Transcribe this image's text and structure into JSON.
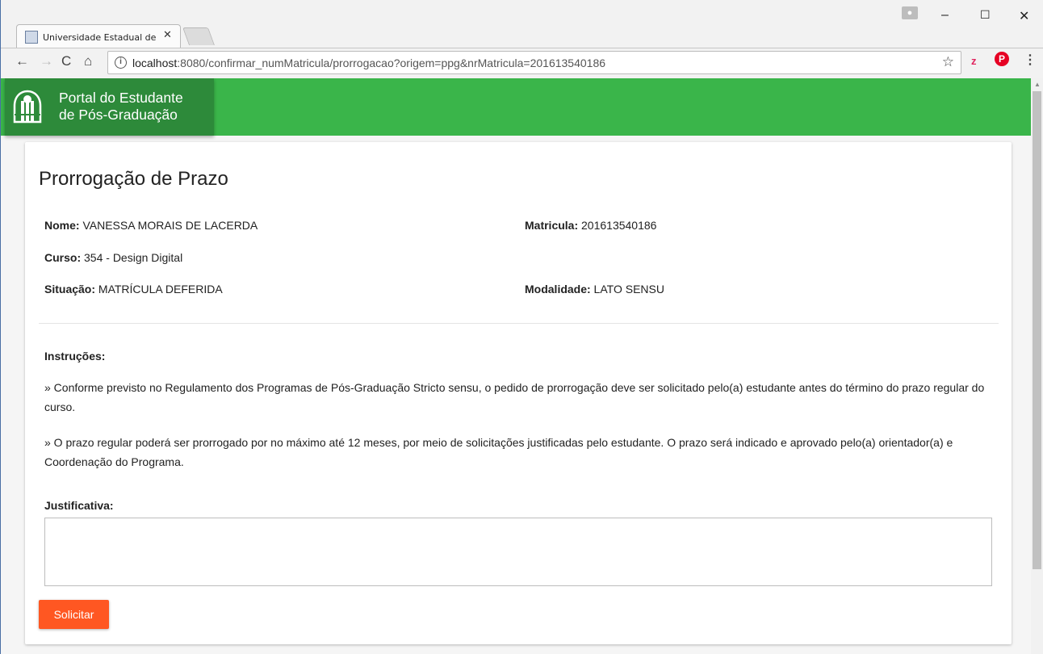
{
  "browser": {
    "tab_title": "Universidade Estadual de",
    "tab_close": "✕",
    "url_host": "localhost",
    "url_rest": ":8080/confirmar_numMatricula/prorrogacao?origem=ppg&nrMatricula=201613540186",
    "ext_z": "z",
    "ext_p": "P",
    "minimize": "–",
    "maximize": "☐",
    "close": "✕"
  },
  "header": {
    "brand_line1": "Portal do Estudante",
    "brand_line2": "de Pós-Graduação"
  },
  "page": {
    "title": "Prorrogação de Prazo"
  },
  "student": {
    "nome_label": "Nome:",
    "nome_value": " VANESSA MORAIS DE LACERDA",
    "matricula_label": "Matricula:",
    "matricula_value": " 201613540186",
    "curso_label": "Curso:",
    "curso_value": " 354 - Design Digital",
    "situacao_label": "Situação:",
    "situacao_value": " MATRÍCULA DEFERIDA",
    "modalidade_label": "Modalidade:",
    "modalidade_value": " LATO SENSU"
  },
  "instructions": {
    "title": "Instruções:",
    "p1": "» Conforme previsto no Regulamento dos Programas de Pós-Graduação Stricto sensu, o pedido de prorrogação deve ser solicitado pelo(a) estudante antes do término do prazo regular do curso.",
    "p2": "» O prazo regular poderá ser prorrogado por no máximo até 12 meses, por meio de solicitações justificadas pelo estudante. O prazo será indicado e aprovado pelo(a) orientador(a) e Coordenação do Programa."
  },
  "form": {
    "justificativa_label": "Justificativa:",
    "justificativa_value": "",
    "submit_label": "Solicitar"
  }
}
